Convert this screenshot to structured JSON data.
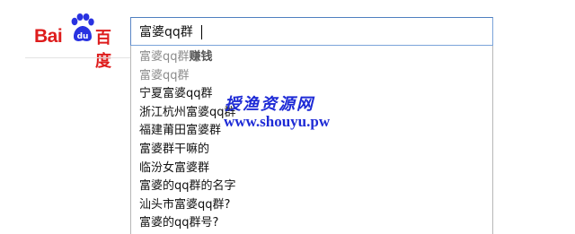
{
  "logo": {
    "latin": "Bai",
    "chinese": "百度",
    "colors": {
      "brand_red": "#de1c1c"
    }
  },
  "search": {
    "value": "富婆qq群",
    "suggestions": [
      {
        "prefix": "富婆qq群",
        "suffix": "赚钱",
        "style": "gray"
      },
      {
        "prefix": "富婆qq群",
        "suffix": "",
        "style": "gray"
      },
      {
        "prefix": "宁夏富婆qq群",
        "suffix": "",
        "style": "normal"
      },
      {
        "prefix": "浙江杭州富婆qq群",
        "suffix": "",
        "style": "normal"
      },
      {
        "prefix": "福建莆田富婆群",
        "suffix": "",
        "style": "normal"
      },
      {
        "prefix": "富婆群干嘛的",
        "suffix": "",
        "style": "normal"
      },
      {
        "prefix": "临汾女富婆群",
        "suffix": "",
        "style": "normal"
      },
      {
        "prefix": "富婆的qq群的名字",
        "suffix": "",
        "style": "normal"
      },
      {
        "prefix": "汕头市富婆qq群?",
        "suffix": "",
        "style": "normal"
      },
      {
        "prefix": "富婆的qq群号?",
        "suffix": "",
        "style": "normal"
      }
    ]
  },
  "watermark": {
    "title": "授渔资源网",
    "url": "www.shouyu.pw",
    "color": "#1e2bd6"
  }
}
